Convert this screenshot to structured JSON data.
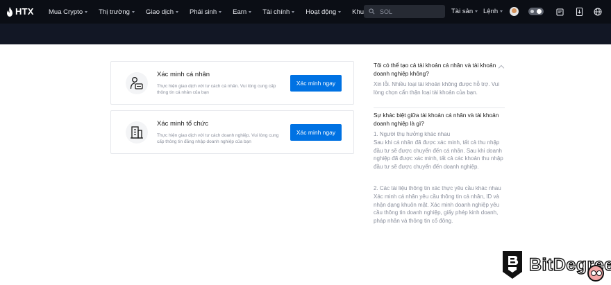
{
  "brand": {
    "logo_text": "HTX"
  },
  "nav": {
    "menu": [
      {
        "label": "Mua Crypto"
      },
      {
        "label": "Thị trường"
      },
      {
        "label": "Giao dịch"
      },
      {
        "label": "Phái sinh"
      },
      {
        "label": "Earn"
      },
      {
        "label": "Tài chính"
      },
      {
        "label": "Hoạt động"
      },
      {
        "label": "Khu $HTX"
      }
    ],
    "search_placeholder": "SOL",
    "assets_label": "Tài sản",
    "orders_label": "Lệnh"
  },
  "cards": [
    {
      "title": "Xác minh cá nhân",
      "desc": "Thực hiện giao dịch với tư cách cá nhân. Vui lòng cung cấp thông tin cá nhân của bạn",
      "button": "Xác minh ngay",
      "icon": "person-id-icon"
    },
    {
      "title": "Xác minh tổ chức",
      "desc": "Thực hiện giao dịch với tư cách doanh nghiệp. Vui lòng cung cấp thông tin đăng nhập doanh nghiệp của bạn",
      "button": "Xác minh ngay",
      "icon": "building-icon"
    }
  ],
  "faq": [
    {
      "q": "Tôi có thể tạo cả tài khoản cá nhân và tài khoản doanh nghiệp không?",
      "a": "Xin lỗi. Nhiều loại tài khoản không được hỗ trợ. Vui lòng chọn cẩn thận loại tài khoản của bạn."
    },
    {
      "q": "Sự khác biệt giữa tài khoản cá nhân và tài khoản doanh nghiệp là gì?",
      "a1": "1. Người thụ hưởng khác nhau\nSau khi cá nhân đã được xác minh, tất cả thu nhập đầu tư sẽ được chuyển đến cá nhân. Sau khi doanh nghiệp đã được xác minh, tất cả các khoản thu nhập đầu tư sẽ được chuyển đến doanh nghiệp.",
      "a2": "2. Các tài liệu thông tin xác thực yêu cầu khác nhau\nXác minh cá nhân yêu cầu thông tin cá nhân, ID và nhận dạng khuôn mặt. Xác minh doanh nghiệp yêu cầu thông tin doanh nghiệp, giấy phép kinh doanh, pháp nhân và thông tin cổ đông."
    }
  ],
  "watermark": {
    "text": "BitDegree"
  }
}
